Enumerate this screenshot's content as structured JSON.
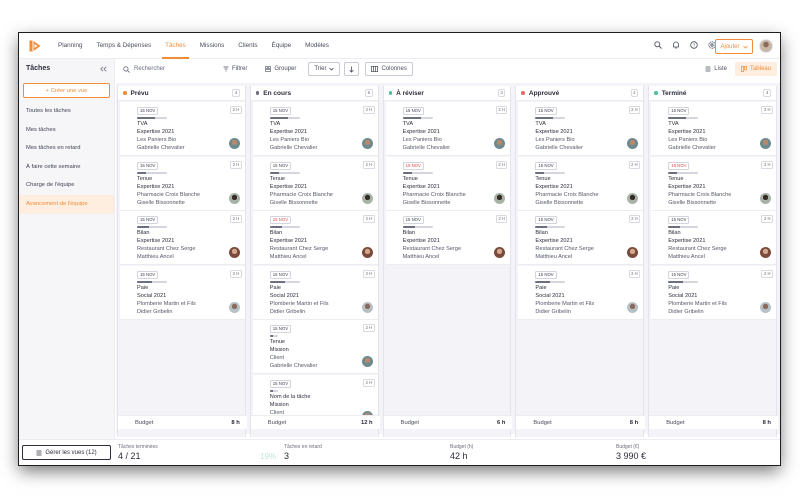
{
  "nav": {
    "items": [
      "Planning",
      "Temps & Dépenses",
      "Tâches",
      "Missions",
      "Clients",
      "Équipe",
      "Modèles"
    ],
    "active": 2
  },
  "topbar": {
    "add_label": "Ajouter",
    "icons": [
      "search-icon",
      "bell-icon",
      "help-icon",
      "settings-icon"
    ]
  },
  "sidebar": {
    "title": "Tâches",
    "create_label": "+ Créer une vue",
    "items": [
      "Toutes les tâches",
      "Mes tâches",
      "Mes tâches en retard",
      "À faire cette semaine",
      "Charge de l'équipe",
      "Avancement de l'équipe"
    ],
    "active": 5
  },
  "toolbar": {
    "search_placeholder": "Rechercher",
    "filter": "Filtrer",
    "group": "Grouper",
    "sort": "Trier",
    "columns": "Colonnes",
    "list": "Liste",
    "board": "Tableau"
  },
  "colors": {
    "accent": "#f28c38",
    "late": "#e04a4a",
    "planned": "#f28c38",
    "in_progress": "#6b6e7e",
    "review": "#4cc1a4",
    "approved": "#f06a6a",
    "done": "#4cc1a4"
  },
  "columns": [
    {
      "title": "Prévu",
      "count": "4",
      "dot": "#f28c38",
      "budget_label": "Budget",
      "budget": "8 h",
      "cards": [
        {
          "date": "15 NOV",
          "late": false,
          "duration": "2 H",
          "progress": 0.6,
          "lines": [
            "TVA",
            "Expertise 2021",
            "Les Paniers Bio",
            "Gabrielle Chevalier"
          ],
          "avatar": "a"
        },
        {
          "date": "15 NOV",
          "late": false,
          "duration": "2 H",
          "progress": 0.3,
          "lines": [
            "Tenue",
            "Expertise 2021",
            "Pharmacie Croix Blanche",
            "Giselle Bissonnette"
          ],
          "avatar": "b"
        },
        {
          "date": "15 NOV",
          "late": false,
          "duration": "2 H",
          "progress": 0.4,
          "lines": [
            "Bilan",
            "Expertise 2021",
            "Restaurant Chez Serge",
            "Matthieu Ancel"
          ],
          "avatar": "c"
        },
        {
          "date": "15 NOV",
          "late": false,
          "duration": "2 H",
          "progress": 0.5,
          "lines": [
            "Paie",
            "Social 2021",
            "Plomberie Martin et Fils",
            "Didier Gribelin"
          ],
          "avatar": "d"
        }
      ]
    },
    {
      "title": "En cours",
      "count": "6",
      "dot": "#6b6e7e",
      "budget_label": "Budget",
      "budget": "12 h",
      "cards": [
        {
          "date": "15 NOV",
          "late": false,
          "duration": "2 H",
          "progress": 0.6,
          "lines": [
            "TVA",
            "Expertise 2021",
            "Les Paniers Bio",
            "Gabrielle Chevalier"
          ],
          "avatar": "a"
        },
        {
          "date": "15 NOV",
          "late": false,
          "duration": "2 H",
          "progress": 0.3,
          "lines": [
            "Tenue",
            "Expertise 2021",
            "Pharmacie Croix Blanche",
            "Giselle Bissonnette"
          ],
          "avatar": "b"
        },
        {
          "date": "15 NOV",
          "late": true,
          "duration": "2 H",
          "progress": 0.4,
          "lines": [
            "Bilan",
            "Expertise 2021",
            "Restaurant Chez Serge",
            "Matthieu Ancel"
          ],
          "avatar": "c"
        },
        {
          "date": "15 NOV",
          "late": false,
          "duration": "2 H",
          "progress": 0.5,
          "lines": [
            "Paie",
            "Social 2021",
            "Plomberie Martin et Fils",
            "Didier Gribelin"
          ],
          "avatar": "d"
        },
        {
          "date": "15 NOV",
          "late": false,
          "duration": "2 H",
          "progress": 0.4,
          "lines": [
            "Tenue",
            "Mission",
            "Client",
            "Gabrielle Chevalier"
          ],
          "avatar": "a"
        },
        {
          "date": "15 NOV",
          "late": false,
          "duration": "2 H",
          "progress": 0.4,
          "lines": [
            "Nom de la tâche",
            "Mission",
            "Client",
            "Gabrielle Chevalier"
          ],
          "avatar": "a"
        }
      ]
    },
    {
      "title": "À réviser",
      "count": "3",
      "dot": "#4cc1a4",
      "budget_label": "Budget",
      "budget": "6 h",
      "cards": [
        {
          "date": "15 NOV",
          "late": false,
          "duration": "2 H",
          "progress": 0.6,
          "lines": [
            "TVA",
            "Expertise 2021",
            "Les Paniers Bio",
            "Gabrielle Chevalier"
          ],
          "avatar": "a"
        },
        {
          "date": "15 NOV",
          "late": true,
          "duration": "2 H",
          "progress": 0.3,
          "lines": [
            "Tenue",
            "Expertise 2021",
            "Pharmacie Croix Blanche",
            "Giselle Bissonnette"
          ],
          "avatar": "b"
        },
        {
          "date": "15 NOV",
          "late": false,
          "duration": "2 H",
          "progress": 0.4,
          "lines": [
            "Bilan",
            "Expertise 2021",
            "Restaurant Chez Serge",
            "Matthieu Ancel"
          ],
          "avatar": "c"
        }
      ]
    },
    {
      "title": "Approuvé",
      "count": "4",
      "dot": "#f06a6a",
      "budget_label": "Budget",
      "budget": "8 h",
      "cards": [
        {
          "date": "15 NOV",
          "late": false,
          "duration": "2 H",
          "progress": 0.6,
          "lines": [
            "TVA",
            "Expertise 2021",
            "Les Paniers Bio",
            "Gabrielle Chevalier"
          ],
          "avatar": "a"
        },
        {
          "date": "15 NOV",
          "late": false,
          "duration": "2 H",
          "progress": 0.3,
          "lines": [
            "Tenue",
            "Expertise 2021",
            "Pharmacie Croix Blanche",
            "Giselle Bissonnette"
          ],
          "avatar": "b"
        },
        {
          "date": "15 NOV",
          "late": false,
          "duration": "2 H",
          "progress": 0.4,
          "lines": [
            "Bilan",
            "Expertise 2021",
            "Restaurant Chez Serge",
            "Matthieu Ancel"
          ],
          "avatar": "c"
        },
        {
          "date": "15 NOV",
          "late": false,
          "duration": "2 H",
          "progress": 0.5,
          "lines": [
            "Paie",
            "Social 2021",
            "Plomberie Martin et Fils",
            "Didier Gribelin"
          ],
          "avatar": "d"
        }
      ]
    },
    {
      "title": "Terminé",
      "count": "4",
      "dot": "#4cc1a4",
      "budget_label": "Budget",
      "budget": "8 h",
      "cards": [
        {
          "date": "15 NOV",
          "late": false,
          "duration": "2 H",
          "progress": 0.6,
          "lines": [
            "TVA",
            "Expertise 2021",
            "Les Paniers Bio",
            "Gabrielle Chevalier"
          ],
          "avatar": "a"
        },
        {
          "date": "15 NOV",
          "late": true,
          "duration": "2 H",
          "progress": 0.3,
          "lines": [
            "Tenue",
            "Expertise 2021",
            "Pharmacie Croix Blanche",
            "Giselle Bissonnette"
          ],
          "avatar": "b"
        },
        {
          "date": "15 NOV",
          "late": false,
          "duration": "2 H",
          "progress": 0.4,
          "lines": [
            "Bilan",
            "Expertise 2021",
            "Restaurant Chez Serge",
            "Matthieu Ancel"
          ],
          "avatar": "c"
        },
        {
          "date": "15 NOV",
          "late": false,
          "duration": "2 H",
          "progress": 0.5,
          "lines": [
            "Paie",
            "Social 2021",
            "Plomberie Martin et Fils",
            "Didier Gribelin"
          ],
          "avatar": "d"
        }
      ]
    }
  ],
  "summary": {
    "manage_views": "Gérer les vues (12)",
    "done_label": "Tâches terminées",
    "done_value": "4 / 21",
    "done_pct": "19%",
    "late_label": "Tâches en retard",
    "late_value": "3",
    "budget_h_label": "Budget (h)",
    "budget_h_value": "42 h",
    "budget_eur_label": "Budget (€)",
    "budget_eur_value": "3 990 €"
  }
}
